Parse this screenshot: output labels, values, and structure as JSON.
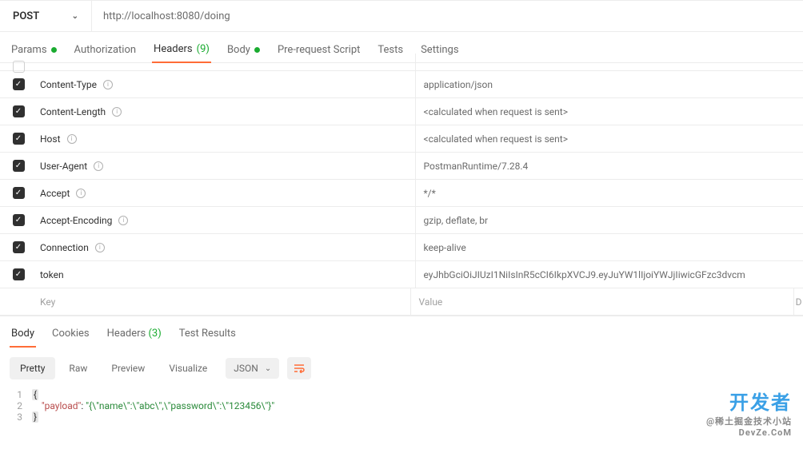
{
  "request": {
    "method": "POST",
    "url": "http://localhost:8080/doing"
  },
  "tabs": {
    "params": "Params",
    "auth": "Authorization",
    "headers": "Headers",
    "headers_count": "(9)",
    "body": "Body",
    "prereq": "Pre-request Script",
    "tests": "Tests",
    "settings": "Settings"
  },
  "headers": [
    {
      "key": "Content-Type",
      "value": "application/json",
      "info": true
    },
    {
      "key": "Content-Length",
      "value": "<calculated when request is sent>",
      "info": true
    },
    {
      "key": "Host",
      "value": "<calculated when request is sent>",
      "info": true
    },
    {
      "key": "User-Agent",
      "value": "PostmanRuntime/7.28.4",
      "info": true
    },
    {
      "key": "Accept",
      "value": "*/*",
      "info": true
    },
    {
      "key": "Accept-Encoding",
      "value": "gzip, deflate, br",
      "info": true
    },
    {
      "key": "Connection",
      "value": "keep-alive",
      "info": true
    },
    {
      "key": "token",
      "value": "eyJhbGciOiJIUzI1NiIsInR5cCI6IkpXVCJ9.eyJuYW1lIjoiYWJjIiwicGFzc3dvcm",
      "info": false
    }
  ],
  "placeholders": {
    "key": "Key",
    "value": "Value",
    "desc": "D"
  },
  "response_tabs": {
    "body": "Body",
    "cookies": "Cookies",
    "headers": "Headers",
    "headers_count": "(3)",
    "tests": "Test Results"
  },
  "view_buttons": {
    "pretty": "Pretty",
    "raw": "Raw",
    "preview": "Preview",
    "visualize": "Visualize"
  },
  "format": "JSON",
  "code": {
    "l1": "{",
    "l2_indent": "    ",
    "l2_key": "\"payload\"",
    "l2_colon": ": ",
    "l2_val": "\"{\\\"name\\\":\\\"abc\\\",\\\"password\\\":\\\"123456\\\"}\"",
    "l3": "}"
  },
  "watermark": {
    "big": "开发者",
    "small": "DevZe.CoM",
    "handle": "@稀土掘金技术小站"
  }
}
